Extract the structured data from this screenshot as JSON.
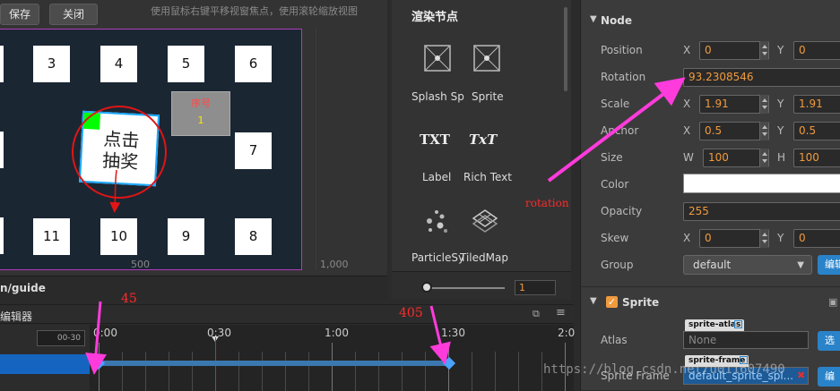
{
  "scene": {
    "save_label": "保存",
    "close_label": "关闭",
    "hint": "使用鼠标右键平移视窗焦点，使用滚轮缩放视图",
    "cards_top": [
      "3",
      "4",
      "5",
      "6"
    ],
    "cards_right": "7",
    "cards_bottom": [
      "11",
      "10",
      "9",
      "8"
    ],
    "panel_title": "序号",
    "panel_number": "1",
    "draw_text": "点击抽奖",
    "ruler_500": "500",
    "ruler_1000": "1,000",
    "path": "n/guide"
  },
  "library": {
    "title": "渲染节点",
    "items": [
      {
        "label": "Splash Sp",
        "icon": "splash-sprite-icon"
      },
      {
        "label": "Sprite",
        "icon": "sprite-icon"
      },
      {
        "label": "Label",
        "glyph": "TXT"
      },
      {
        "label": "Rich Text",
        "glyph": "TxT"
      },
      {
        "label": "ParticleSy",
        "icon": "particle-system-icon"
      },
      {
        "label": "TiledMap",
        "icon": "tiledmap-icon"
      }
    ],
    "zoom_value": "1"
  },
  "properties": {
    "node_section": "Node",
    "position": {
      "label": "Position",
      "x": "0",
      "y": "0"
    },
    "rotation": {
      "label": "Rotation",
      "value": "93.2308546"
    },
    "scale": {
      "label": "Scale",
      "x": "1.91",
      "y": "1.91"
    },
    "anchor": {
      "label": "Anchor",
      "x": "0.5",
      "y": "0.5"
    },
    "size": {
      "label": "Size",
      "w": "100",
      "h": "100"
    },
    "color": {
      "label": "Color",
      "value": "#ffffff"
    },
    "opacity": {
      "label": "Opacity",
      "value": "255"
    },
    "skew": {
      "label": "Skew",
      "x": "0",
      "y": "0"
    },
    "group": {
      "label": "Group",
      "value": "default",
      "edit_label": "编辑"
    },
    "sprite_section": "Sprite",
    "atlas": {
      "label": "Atlas",
      "tag": "sprite-atlas",
      "value": "None",
      "button": "选"
    },
    "sprite_frame": {
      "label": "Sprite Frame",
      "tag": "sprite-frame",
      "value": "default_sprite_spl...",
      "button": "编"
    },
    "axis_x": "X",
    "axis_y": "Y",
    "axis_w": "W",
    "axis_h": "H"
  },
  "timeline": {
    "title": "编辑器",
    "current_time": "00-30",
    "ticks": [
      "0:00",
      "0:30",
      "1:00",
      "1:30",
      "2:0"
    ]
  },
  "annotations": {
    "rotation_note": "rotation",
    "frame_45": "45",
    "frame_405": "405",
    "watermark": "https://blog.csdn.net/u011607490"
  },
  "colors": {
    "accent_orange": "#f09a3e",
    "canvas_border": "#b23bbd",
    "annotation_magenta": "#ff3bdc",
    "annotation_red": "#e01515",
    "keyframe_blue": "#4aa3ff"
  }
}
